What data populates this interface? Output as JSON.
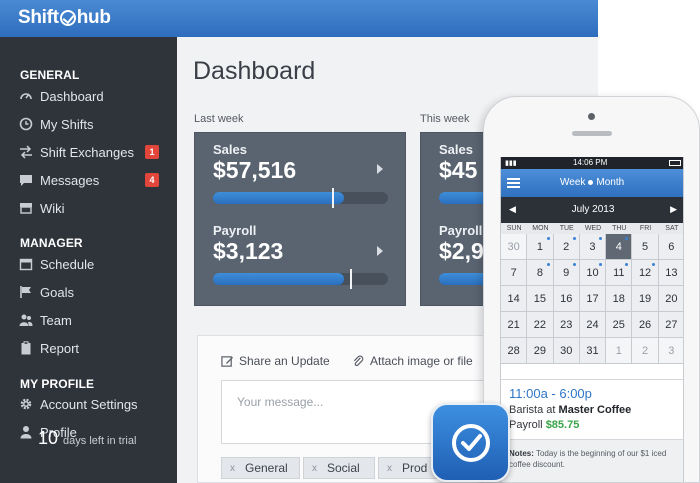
{
  "app": {
    "brand_left": "Shift",
    "brand_right": "hub",
    "accent_color": "#2e6dbd"
  },
  "sidebar": {
    "sections": [
      {
        "heading": "GENERAL",
        "items": [
          {
            "label": "Dashboard",
            "icon": "speedometer-icon"
          },
          {
            "label": "My Shifts",
            "icon": "clock-icon"
          },
          {
            "label": "Shift Exchanges",
            "icon": "swap-icon",
            "badge": "1"
          },
          {
            "label": "Messages",
            "icon": "chat-icon",
            "badge": "4"
          },
          {
            "label": "Wiki",
            "icon": "archive-icon"
          }
        ]
      },
      {
        "heading": "MANAGER",
        "items": [
          {
            "label": "Schedule",
            "icon": "calendar-icon"
          },
          {
            "label": "Goals",
            "icon": "flag-icon"
          },
          {
            "label": "Team",
            "icon": "team-icon"
          },
          {
            "label": "Report",
            "icon": "clipboard-icon"
          }
        ]
      },
      {
        "heading": "MY PROFILE",
        "items": [
          {
            "label": "Account Settings",
            "icon": "gear-icon"
          },
          {
            "label": "Profile",
            "icon": "user-icon"
          }
        ]
      }
    ],
    "trial_count": "10",
    "trial_text": "days left in trial"
  },
  "dashboard": {
    "title": "Dashboard",
    "periods": [
      {
        "label": "Last week",
        "sales_label": "Sales",
        "sales_value": "$57,516",
        "sales_progress": 0.75,
        "sales_marker": 0.68,
        "payroll_label": "Payroll",
        "payroll_value": "$3,123",
        "payroll_progress": 0.75,
        "payroll_marker": 0.78
      },
      {
        "label": "This week",
        "sales_label": "Sales",
        "sales_value": "$45",
        "sales_progress": 0.55,
        "sales_marker": 0.55,
        "payroll_label": "Payroll",
        "payroll_value": "$2,9",
        "payroll_progress": 0.55,
        "payroll_marker": 0.55
      }
    ],
    "update": {
      "share_label": "Share an Update",
      "attach_label": "Attach image or file",
      "message_placeholder": "Your message...",
      "tags": [
        "General",
        "Social",
        "Prod"
      ],
      "tag_remove": "x"
    }
  },
  "phone": {
    "status_time": "14:06 PM",
    "segment_week": "Week",
    "segment_month": "Month",
    "month_title": "July 2013",
    "prev": "◀",
    "next": "▶",
    "weekdays": [
      "SUN",
      "MON",
      "TUE",
      "WED",
      "THU",
      "FRI",
      "SAT"
    ],
    "weeks": [
      [
        "30",
        "1",
        "2",
        "3",
        "4",
        "5",
        "6"
      ],
      [
        "7",
        "8",
        "9",
        "10",
        "11",
        "12",
        "13"
      ],
      [
        "14",
        "15",
        "16",
        "17",
        "18",
        "19",
        "20"
      ],
      [
        "21",
        "22",
        "23",
        "24",
        "25",
        "26",
        "27"
      ],
      [
        "28",
        "29",
        "30",
        "31",
        "1",
        "2",
        "3"
      ]
    ],
    "selected_day": "4",
    "shift": {
      "time": "11:00a - 6:00p",
      "role_prefix": "Barista at",
      "location": "Master Coffee",
      "pay_label": "Payroll",
      "pay_value": "$85.75"
    },
    "notes_label": "Notes:",
    "notes_text": "Today is the beginning of our $1 iced coffee discount."
  }
}
